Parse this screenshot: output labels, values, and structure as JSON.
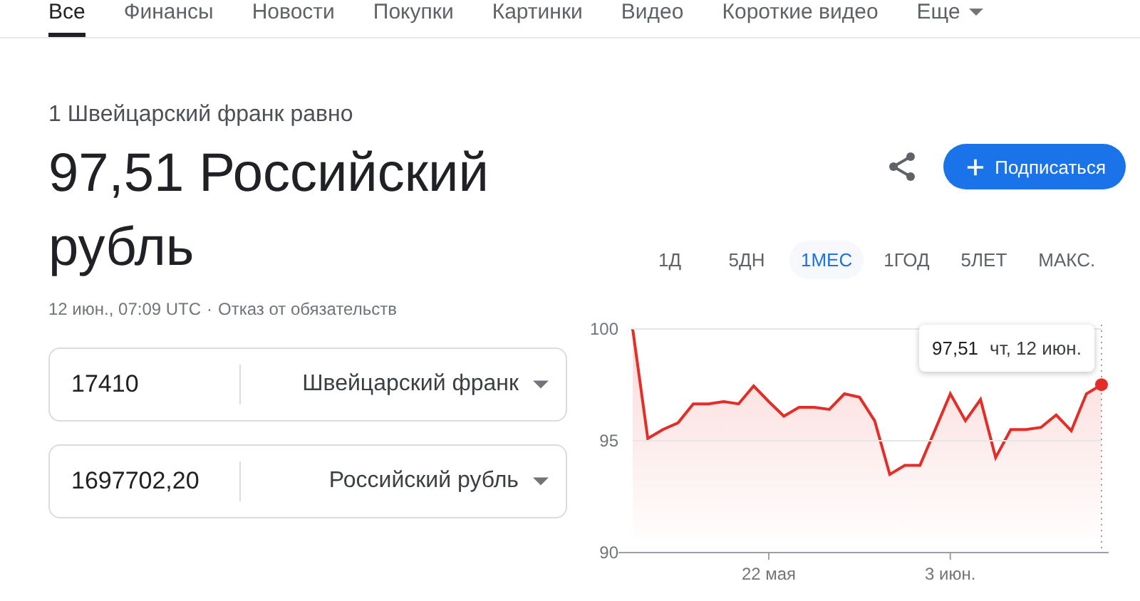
{
  "nav": [
    {
      "label": "Все",
      "selected": true
    },
    {
      "label": "Финансы",
      "selected": false
    },
    {
      "label": "Новости",
      "selected": false
    },
    {
      "label": "Покупки",
      "selected": false
    },
    {
      "label": "Картинки",
      "selected": false
    },
    {
      "label": "Видео",
      "selected": false
    },
    {
      "label": "Короткие видео",
      "selected": false
    },
    {
      "label": "Еще",
      "selected": false,
      "dropdown": true
    }
  ],
  "summary": {
    "subtitle": "1 Швейцарский франк равно",
    "value": "97,51 Российский рубль",
    "meta": "12 июн., 07:09 UTC",
    "separator": "·",
    "disclaimer": "Отказ от обязательств"
  },
  "subscribe_button": "Подписаться",
  "converter": [
    {
      "amount": "17410",
      "currency": "Швейцарский франк"
    },
    {
      "amount": "1697702,20",
      "currency": "Российский рубль"
    }
  ],
  "periods": [
    {
      "label": "1Д",
      "selected": false
    },
    {
      "label": "5ДН",
      "selected": false
    },
    {
      "label": "1МЕС",
      "selected": true
    },
    {
      "label": "1ГОД",
      "selected": false
    },
    {
      "label": "5ЛЕТ",
      "selected": false
    },
    {
      "label": "МАКС.",
      "selected": false
    }
  ],
  "tooltip": {
    "value": "97,51",
    "date": "чт, 12 июн."
  },
  "chart_data": {
    "type": "area",
    "categories": [
      null,
      null,
      null,
      null,
      null,
      null,
      null,
      null,
      null,
      "22 мая",
      null,
      null,
      null,
      null,
      null,
      null,
      null,
      null,
      null,
      null,
      null,
      "3 июн.",
      null,
      null,
      null,
      null,
      null,
      null,
      null,
      null,
      null,
      null
    ],
    "series": [
      {
        "color": "#e52d27",
        "values": [
          100,
          95.1,
          95.5,
          95.8,
          96.65,
          96.65,
          96.75,
          96.65,
          97.45,
          96.75,
          96.1,
          96.5,
          96.5,
          96.4,
          97.1,
          96.95,
          95.9,
          93.5,
          93.9,
          93.9,
          95.5,
          97.1,
          95.9,
          96.85,
          94.25,
          95.5,
          95.5,
          95.6,
          96.15,
          95.45,
          97.1,
          97.51
        ]
      }
    ],
    "ylim": [
      90,
      100
    ],
    "yticks": [
      90,
      95,
      100
    ],
    "grid": true
  }
}
